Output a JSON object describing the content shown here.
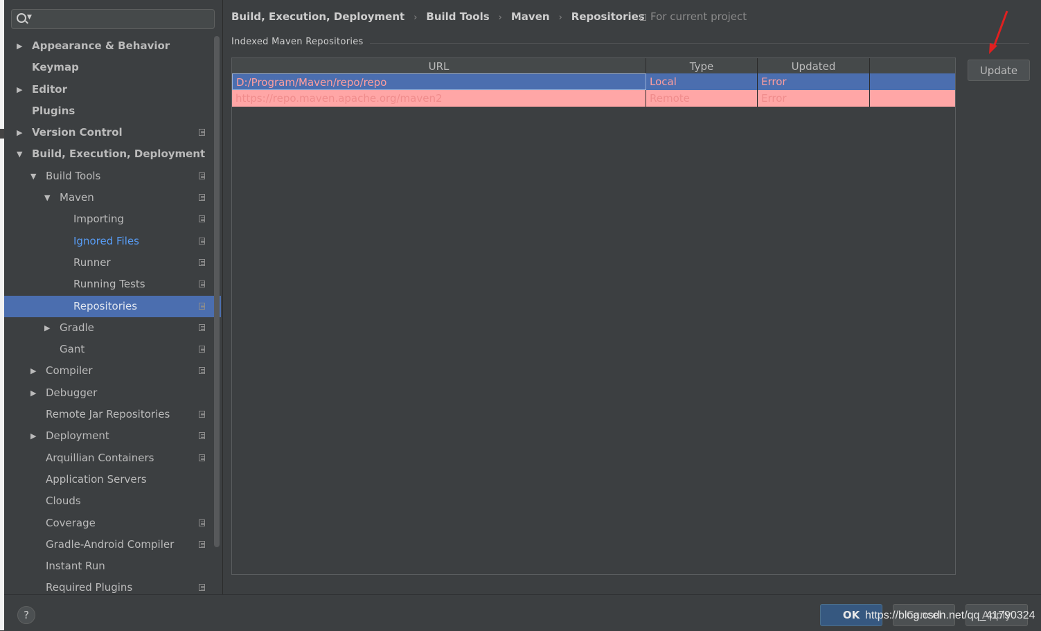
{
  "search": {
    "placeholder": ""
  },
  "sidebar": {
    "items": [
      {
        "label": "Appearance & Behavior",
        "level": 0,
        "arrow": "right",
        "bold": true,
        "project_icon": false
      },
      {
        "label": "Keymap",
        "level": 0,
        "arrow": "none",
        "bold": true,
        "project_icon": false
      },
      {
        "label": "Editor",
        "level": 0,
        "arrow": "right",
        "bold": true,
        "project_icon": false
      },
      {
        "label": "Plugins",
        "level": 0,
        "arrow": "none",
        "bold": true,
        "project_icon": false
      },
      {
        "label": "Version Control",
        "level": 0,
        "arrow": "right",
        "bold": true,
        "project_icon": true
      },
      {
        "label": "Build, Execution, Deployment",
        "level": 0,
        "arrow": "down",
        "bold": true,
        "project_icon": false
      },
      {
        "label": "Build Tools",
        "level": 1,
        "arrow": "down",
        "bold": false,
        "project_icon": true
      },
      {
        "label": "Maven",
        "level": 2,
        "arrow": "down",
        "bold": false,
        "project_icon": true
      },
      {
        "label": "Importing",
        "level": 3,
        "arrow": "none",
        "bold": false,
        "project_icon": true
      },
      {
        "label": "Ignored Files",
        "level": 3,
        "arrow": "none",
        "bold": false,
        "project_icon": true,
        "link": true
      },
      {
        "label": "Runner",
        "level": 3,
        "arrow": "none",
        "bold": false,
        "project_icon": true
      },
      {
        "label": "Running Tests",
        "level": 3,
        "arrow": "none",
        "bold": false,
        "project_icon": true
      },
      {
        "label": "Repositories",
        "level": 3,
        "arrow": "none",
        "bold": false,
        "project_icon": true,
        "selected": true
      },
      {
        "label": "Gradle",
        "level": 2,
        "arrow": "right",
        "bold": false,
        "project_icon": true
      },
      {
        "label": "Gant",
        "level": 2,
        "arrow": "none",
        "bold": false,
        "project_icon": true
      },
      {
        "label": "Compiler",
        "level": 1,
        "arrow": "right",
        "bold": false,
        "project_icon": true
      },
      {
        "label": "Debugger",
        "level": 1,
        "arrow": "right",
        "bold": false,
        "project_icon": false
      },
      {
        "label": "Remote Jar Repositories",
        "level": 1,
        "arrow": "none",
        "bold": false,
        "project_icon": true
      },
      {
        "label": "Deployment",
        "level": 1,
        "arrow": "right",
        "bold": false,
        "project_icon": true
      },
      {
        "label": "Arquillian Containers",
        "level": 1,
        "arrow": "none",
        "bold": false,
        "project_icon": true
      },
      {
        "label": "Application Servers",
        "level": 1,
        "arrow": "none",
        "bold": false,
        "project_icon": false
      },
      {
        "label": "Clouds",
        "level": 1,
        "arrow": "none",
        "bold": false,
        "project_icon": false
      },
      {
        "label": "Coverage",
        "level": 1,
        "arrow": "none",
        "bold": false,
        "project_icon": true
      },
      {
        "label": "Gradle-Android Compiler",
        "level": 1,
        "arrow": "none",
        "bold": false,
        "project_icon": true
      },
      {
        "label": "Instant Run",
        "level": 1,
        "arrow": "none",
        "bold": false,
        "project_icon": false
      },
      {
        "label": "Required Plugins",
        "level": 1,
        "arrow": "none",
        "bold": false,
        "project_icon": true
      }
    ]
  },
  "breadcrumb": [
    "Build, Execution, Deployment",
    "Build Tools",
    "Maven",
    "Repositories"
  ],
  "breadcrumb_separator": "›",
  "scope_label": "For current project",
  "section_title": "Indexed Maven Repositories",
  "table": {
    "columns": [
      "URL",
      "Type",
      "Updated",
      ""
    ],
    "rows": [
      {
        "url": "D:/Program/Maven/repo/repo",
        "type": "Local",
        "updated": "Error",
        "extra": ""
      },
      {
        "url": "https://repo.maven.apache.org/maven2",
        "type": "Remote",
        "updated": "Error",
        "extra": ""
      }
    ]
  },
  "update_button": "Update",
  "footer": {
    "help": "?",
    "ok": "OK",
    "cancel": "Cancel",
    "apply": "Apply"
  },
  "watermark": "https://blog.csdn.net/qq_41790324",
  "colors": {
    "background": "#3c3f41",
    "selection": "#4b6eaf",
    "error_row": "#ffa6a6",
    "link": "#589df6",
    "annotation_arrow": "#e02020"
  },
  "icons": {
    "search": "search-icon",
    "project_scope": "project-scope-icon",
    "expand": "triangle-right-icon",
    "collapse": "triangle-down-icon",
    "annotation": "red-arrow-icon"
  }
}
